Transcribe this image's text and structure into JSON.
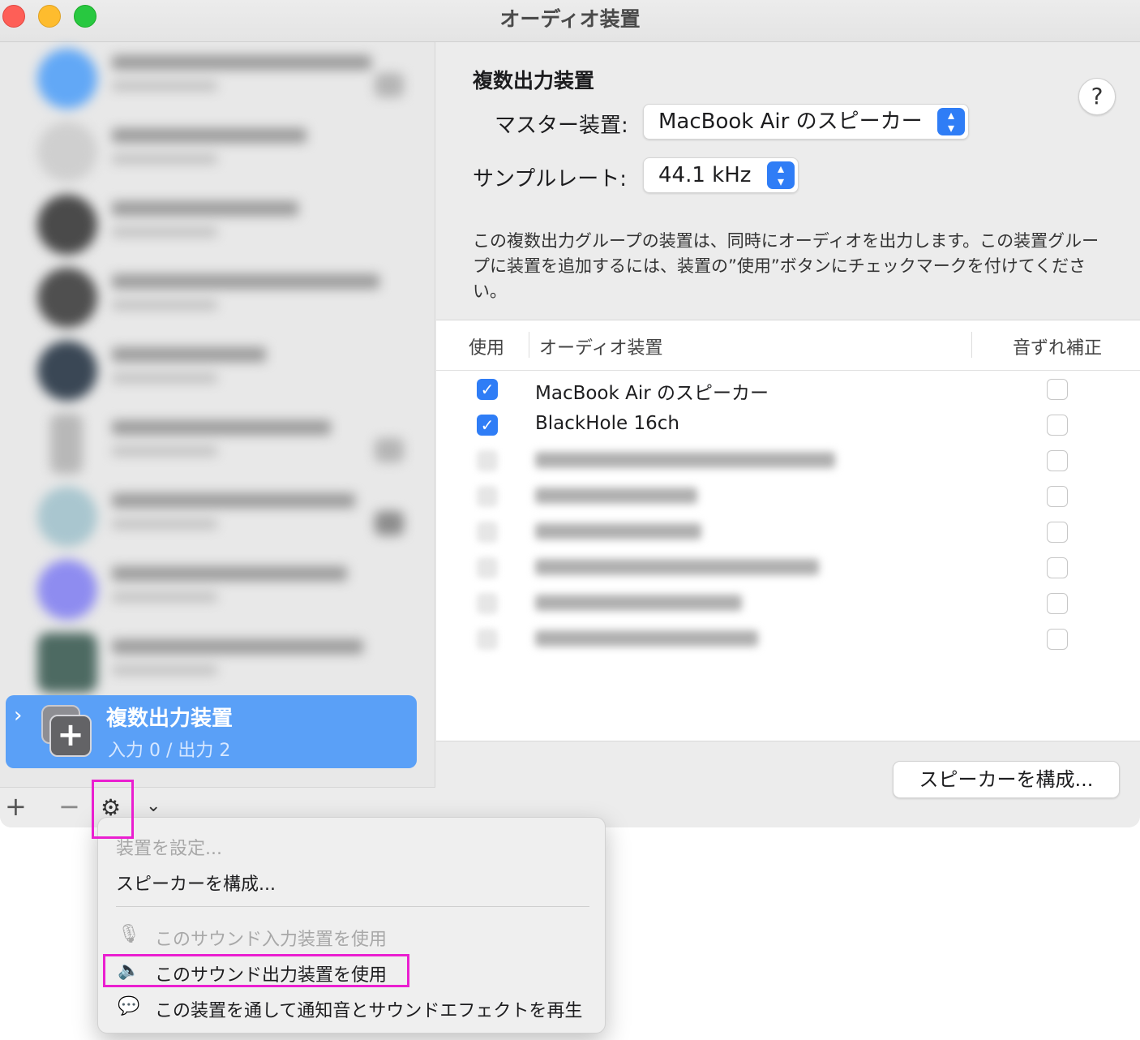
{
  "window": {
    "title": "オーディオ装置"
  },
  "colors": {
    "accent": "#2f7df6",
    "selection": "#5aa0f7",
    "highlight": "#ea1fd0"
  },
  "sidebar": {
    "selected": {
      "name": "複数出力装置",
      "subtitle": "入力 0 / 出力 2"
    },
    "footer": {
      "add_icon": "plus-icon",
      "remove_icon": "minus-icon",
      "action_icon": "gear-icon",
      "menu_icon": "chevron-down-icon"
    }
  },
  "detail": {
    "title": "複数出力装置",
    "help_label": "?",
    "master_label": "マスター装置:",
    "master_value": "MacBook Air のスピーカー",
    "rate_label": "サンプルレート:",
    "rate_value": "44.1 kHz",
    "description": "この複数出力グループの装置は、同時にオーディオを出力します。この装置グループに装置を追加するには、装置の”使用”ボタンにチェックマークを付けてください。",
    "table": {
      "headers": {
        "use": "使用",
        "device": "オーディオ装置",
        "drift": "音ずれ補正"
      },
      "rows": [
        {
          "name": "MacBook Air のスピーカー",
          "use": true,
          "drift": false
        },
        {
          "name": "BlackHole 16ch",
          "use": true,
          "drift": false
        }
      ]
    },
    "configure_button": "スピーカーを構成..."
  },
  "menu": {
    "items": [
      {
        "label": "装置を設定...",
        "enabled": false
      },
      {
        "label": "スピーカーを構成...",
        "enabled": true
      },
      {
        "label": "このサウンド入力装置を使用",
        "enabled": false,
        "icon": "microphone-icon"
      },
      {
        "label": "このサウンド出力装置を使用",
        "enabled": true,
        "icon": "speaker-icon"
      },
      {
        "label": "この装置を通して通知音とサウンドエフェクトを再生",
        "enabled": true,
        "icon": "alert-bubble-icon"
      }
    ]
  }
}
